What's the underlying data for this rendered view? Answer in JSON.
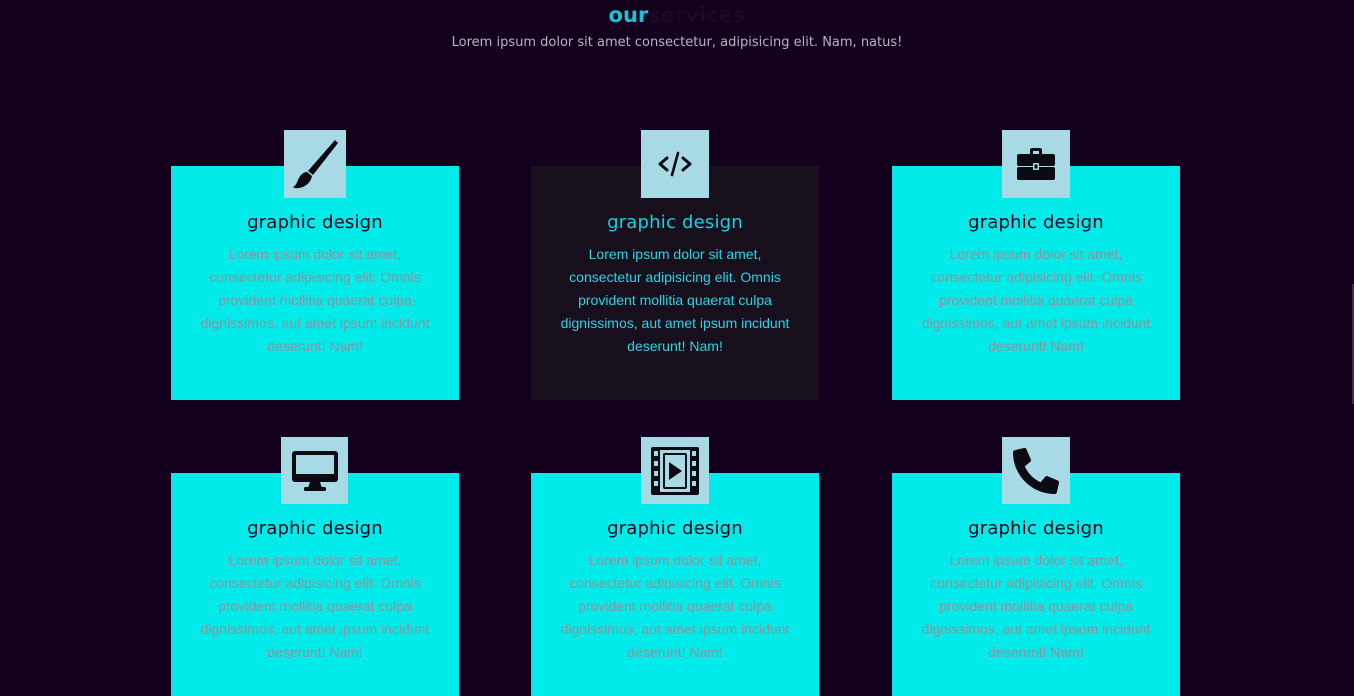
{
  "section": {
    "heading_accent": "our",
    "heading_main": "services",
    "subtitle": "Lorem ipsum dolor sit amet consectetur, adipisicing elit. Nam, natus!"
  },
  "colors": {
    "background": "#12001c",
    "card": "#00ebe9",
    "card_active": "#170f1c",
    "icon_bg": "#a8dae6",
    "accent": "#19c4d3"
  },
  "cards": [
    {
      "icon": "paintbrush-icon",
      "title": "graphic design",
      "text": "Lorem ipsum dolor sit amet, consectetur adipisicing elit. Omnis provident mollitia quaerat culpa dignissimos, aut amet ipsum incidunt deserunt! Nam!"
    },
    {
      "icon": "code-icon",
      "title": "graphic design",
      "text": "Lorem ipsum dolor sit amet, consectetur adipisicing elit. Omnis provident mollitia quaerat culpa dignissimos, aut amet ipsum incidunt deserunt! Nam!",
      "active": true
    },
    {
      "icon": "briefcase-icon",
      "title": "graphic design",
      "text": "Lorem ipsum dolor sit amet, consectetur adipisicing elit. Omnis provident mollitia quaerat culpa dignissimos, aut amet ipsum incidunt deserunt! Nam!"
    },
    {
      "icon": "desktop-icon",
      "title": "graphic design",
      "text": "Lorem ipsum dolor sit amet, consectetur adipisicing elit. Omnis provident mollitia quaerat culpa dignissimos, aut amet ipsum incidunt deserunt! Nam!"
    },
    {
      "icon": "film-icon",
      "title": "graphic design",
      "text": "Lorem ipsum dolor sit amet, consectetur adipisicing elit. Omnis provident mollitia quaerat culpa dignissimos, aut amet ipsum incidunt deserunt! Nam!"
    },
    {
      "icon": "phone-icon",
      "title": "graphic design",
      "text": "Lorem ipsum dolor sit amet, consectetur adipisicing elit. Omnis provident mollitia quaerat culpa dignissimos, aut amet ipsum incidunt deserunt! Nam!"
    }
  ]
}
